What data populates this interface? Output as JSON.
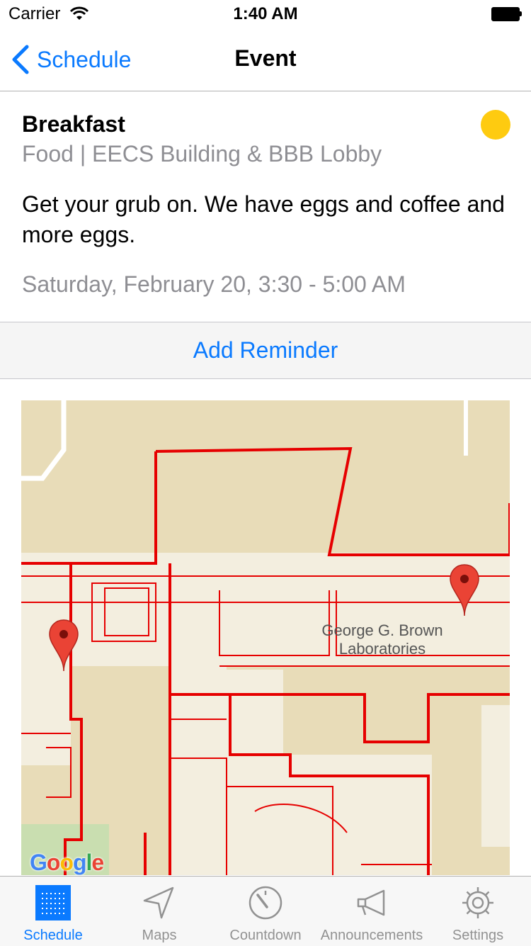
{
  "status_bar": {
    "carrier": "Carrier",
    "time": "1:40 AM"
  },
  "nav": {
    "back_label": "Schedule",
    "title": "Event"
  },
  "event": {
    "title": "Breakfast",
    "subtitle": "Food | EECS Building & BBB Lobby",
    "description": "Get your grub on. We have eggs and coffee and more eggs.",
    "time": "Saturday, February 20, 3:30 - 5:00 AM",
    "dot_color": "#fecb10"
  },
  "reminder": {
    "label": "Add Reminder"
  },
  "map": {
    "label_line1": "George G. Brown",
    "label_line2": "Laboratories",
    "logo": "Google",
    "outline_color": "#e60000",
    "pin_color": "#ea4335"
  },
  "tabs": [
    {
      "label": "Schedule",
      "icon": "grid-icon",
      "active": true
    },
    {
      "label": "Maps",
      "icon": "location-arrow-icon",
      "active": false
    },
    {
      "label": "Countdown",
      "icon": "timer-icon",
      "active": false
    },
    {
      "label": "Announcements",
      "icon": "megaphone-icon",
      "active": false
    },
    {
      "label": "Settings",
      "icon": "gear-icon",
      "active": false
    }
  ],
  "colors": {
    "accent": "#0a7aff",
    "inactive": "#929292"
  }
}
